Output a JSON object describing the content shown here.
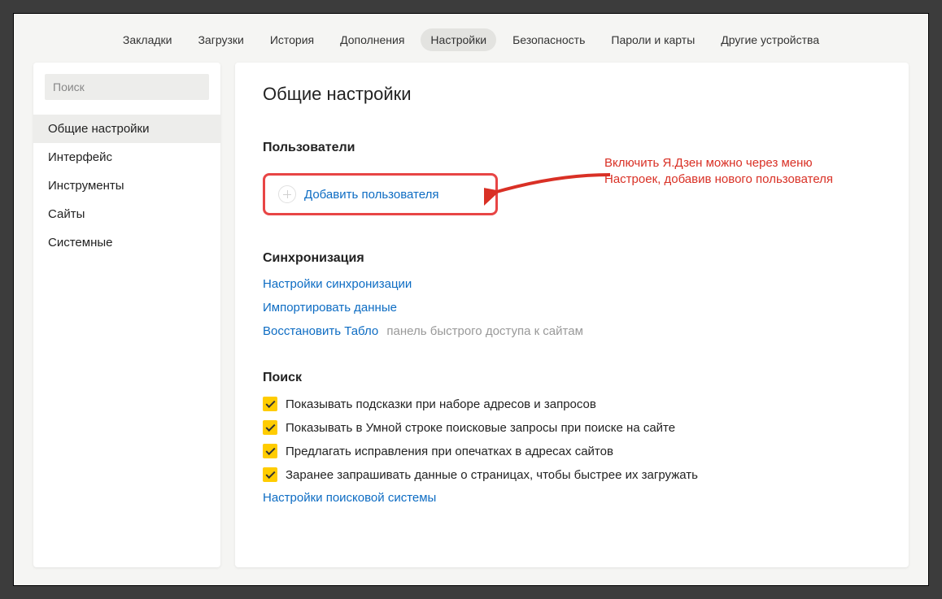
{
  "topNav": {
    "items": [
      {
        "label": "Закладки"
      },
      {
        "label": "Загрузки"
      },
      {
        "label": "История"
      },
      {
        "label": "Дополнения"
      },
      {
        "label": "Настройки",
        "active": true
      },
      {
        "label": "Безопасность"
      },
      {
        "label": "Пароли и карты"
      },
      {
        "label": "Другие устройства"
      }
    ]
  },
  "sidebar": {
    "searchPlaceholder": "Поиск",
    "items": [
      {
        "label": "Общие настройки",
        "active": true
      },
      {
        "label": "Интерфейс"
      },
      {
        "label": "Инструменты"
      },
      {
        "label": "Сайты"
      },
      {
        "label": "Системные"
      }
    ]
  },
  "main": {
    "title": "Общие настройки",
    "users": {
      "title": "Пользователи",
      "addButton": "Добавить пользователя",
      "annotation": "Включить Я.Дзен можно через меню Настроек, добавив нового пользователя"
    },
    "sync": {
      "title": "Синхронизация",
      "links": [
        {
          "text": "Настройки синхронизации"
        },
        {
          "text": "Импортировать данные"
        },
        {
          "text": "Восстановить Табло",
          "hint": "панель быстрого доступа к сайтам"
        }
      ]
    },
    "search": {
      "title": "Поиск",
      "options": [
        {
          "label": "Показывать подсказки при наборе адресов и запросов",
          "checked": true
        },
        {
          "label": "Показывать в Умной строке поисковые запросы при поиске на сайте",
          "checked": true
        },
        {
          "label": "Предлагать исправления при опечатках в адресах сайтов",
          "checked": true
        },
        {
          "label": "Заранее запрашивать данные о страницах, чтобы быстрее их загружать",
          "checked": true
        }
      ],
      "engineLink": "Настройки поисковой системы"
    }
  }
}
